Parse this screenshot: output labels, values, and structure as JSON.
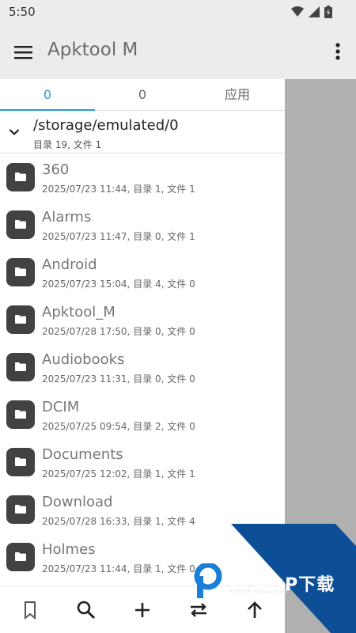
{
  "status_bar": {
    "time": "5:50"
  },
  "app_bar": {
    "title": "Apktool M"
  },
  "tabs": [
    {
      "label": "0",
      "active": true
    },
    {
      "label": "0",
      "active": false
    },
    {
      "label": "应用",
      "active": false
    }
  ],
  "path": {
    "current": "/storage/emulated/0",
    "summary": "目录 19, 文件 1"
  },
  "files": [
    {
      "name": "360",
      "meta": "2025/07/23 11:44, 目录 1, 文件 1"
    },
    {
      "name": "Alarms",
      "meta": "2025/07/23 11:47, 目录 0, 文件 1"
    },
    {
      "name": "Android",
      "meta": "2025/07/23 15:04, 目录 4, 文件 0"
    },
    {
      "name": "Apktool_M",
      "meta": "2025/07/28 17:50, 目录 0, 文件 0"
    },
    {
      "name": "Audiobooks",
      "meta": "2025/07/23 11:31, 目录 0, 文件 0"
    },
    {
      "name": "DCIM",
      "meta": "2025/07/25 09:54, 目录 2, 文件 0"
    },
    {
      "name": "Documents",
      "meta": "2025/07/25 12:02, 目录 1, 文件 1"
    },
    {
      "name": "Download",
      "meta": "2025/07/28 16:33, 目录 1, 文件 4"
    },
    {
      "name": "Holmes",
      "meta": "2025/07/23 11:44, 目录 1, 文件 0"
    }
  ],
  "bottom_bar": [
    "bookmark-icon",
    "search-icon",
    "add-icon",
    "swap-icon",
    "arrow-up-icon"
  ],
  "watermark": {
    "brand": "PCPOP下载",
    "sub": "PCPOP Download"
  },
  "colors": {
    "accent": "#2a9ae0",
    "folder": "#424242",
    "panel_grey": "#b0b0b0",
    "watermark_blue": "#0d4f96"
  }
}
